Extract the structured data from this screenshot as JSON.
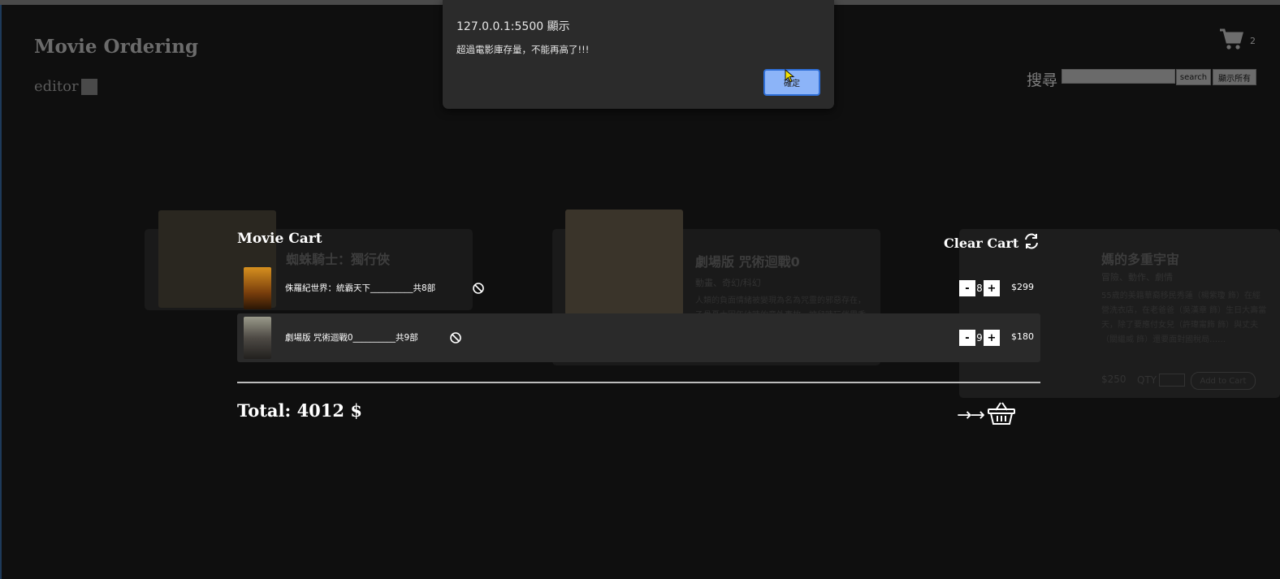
{
  "header": {
    "title": "Movie Ordering",
    "editor_label": "editor",
    "cart_count": "2",
    "search_label": "搜尋",
    "search_value": "",
    "search_button": "search",
    "show_all_button": "顯示所有"
  },
  "background_cards": [
    {
      "title": "蜘蛛騎士：獨行俠",
      "poster_color": "#3a3528"
    },
    {
      "title": "劇場版 咒術迴戰0",
      "tags": "動畫、奇幻/科幻",
      "description": "人類的負面情緒被變現為名為咒靈的邪惡存在，乙骨憂太因年幼時的意外事故，被兒時玩伴里香的咒靈附身……",
      "poster_color": "#4a4438"
    },
    {
      "title": "媽的多重宇宙",
      "tags": "冒險、動作、劇情",
      "description": "55歲的美籍華裔移民秀蓮（楊紫瓊 飾）在經營洗衣店，在老爸爸（吳漢章 飾）生日大壽當天，除了要應付女兒（許瑋甯飾 飾）與丈夫（關繼威 飾）還要面對國稅局……",
      "price": "$250",
      "qty_label": "QTY",
      "add_button": "Add to Cart"
    }
  ],
  "cart": {
    "title": "Movie Cart",
    "clear_label": "Clear Cart",
    "items": [
      {
        "name": "侏羅紀世界：統霸天下",
        "count_text": "共8部",
        "qty": "8",
        "price": "$299",
        "poster_color": "#c07a1c"
      },
      {
        "name": "劇場版 咒術迴戰0",
        "count_text": "共9部",
        "qty": "9",
        "price": "$180",
        "poster_color": "#6a6a6a"
      }
    ],
    "minus": "-",
    "plus": "+",
    "total": "Total: 4012 $",
    "checkout_arrows": "→→"
  },
  "alert": {
    "origin": "127.0.0.1:5500 顯示",
    "message": "超過電影庫存量，不能再高了!!!",
    "ok_button": "確定"
  },
  "colors": {
    "background": "#0f0f0f",
    "row_alt": "#2a2a2a",
    "dialog": "#2b2b2b",
    "ok_button": "#8cb4f8"
  }
}
